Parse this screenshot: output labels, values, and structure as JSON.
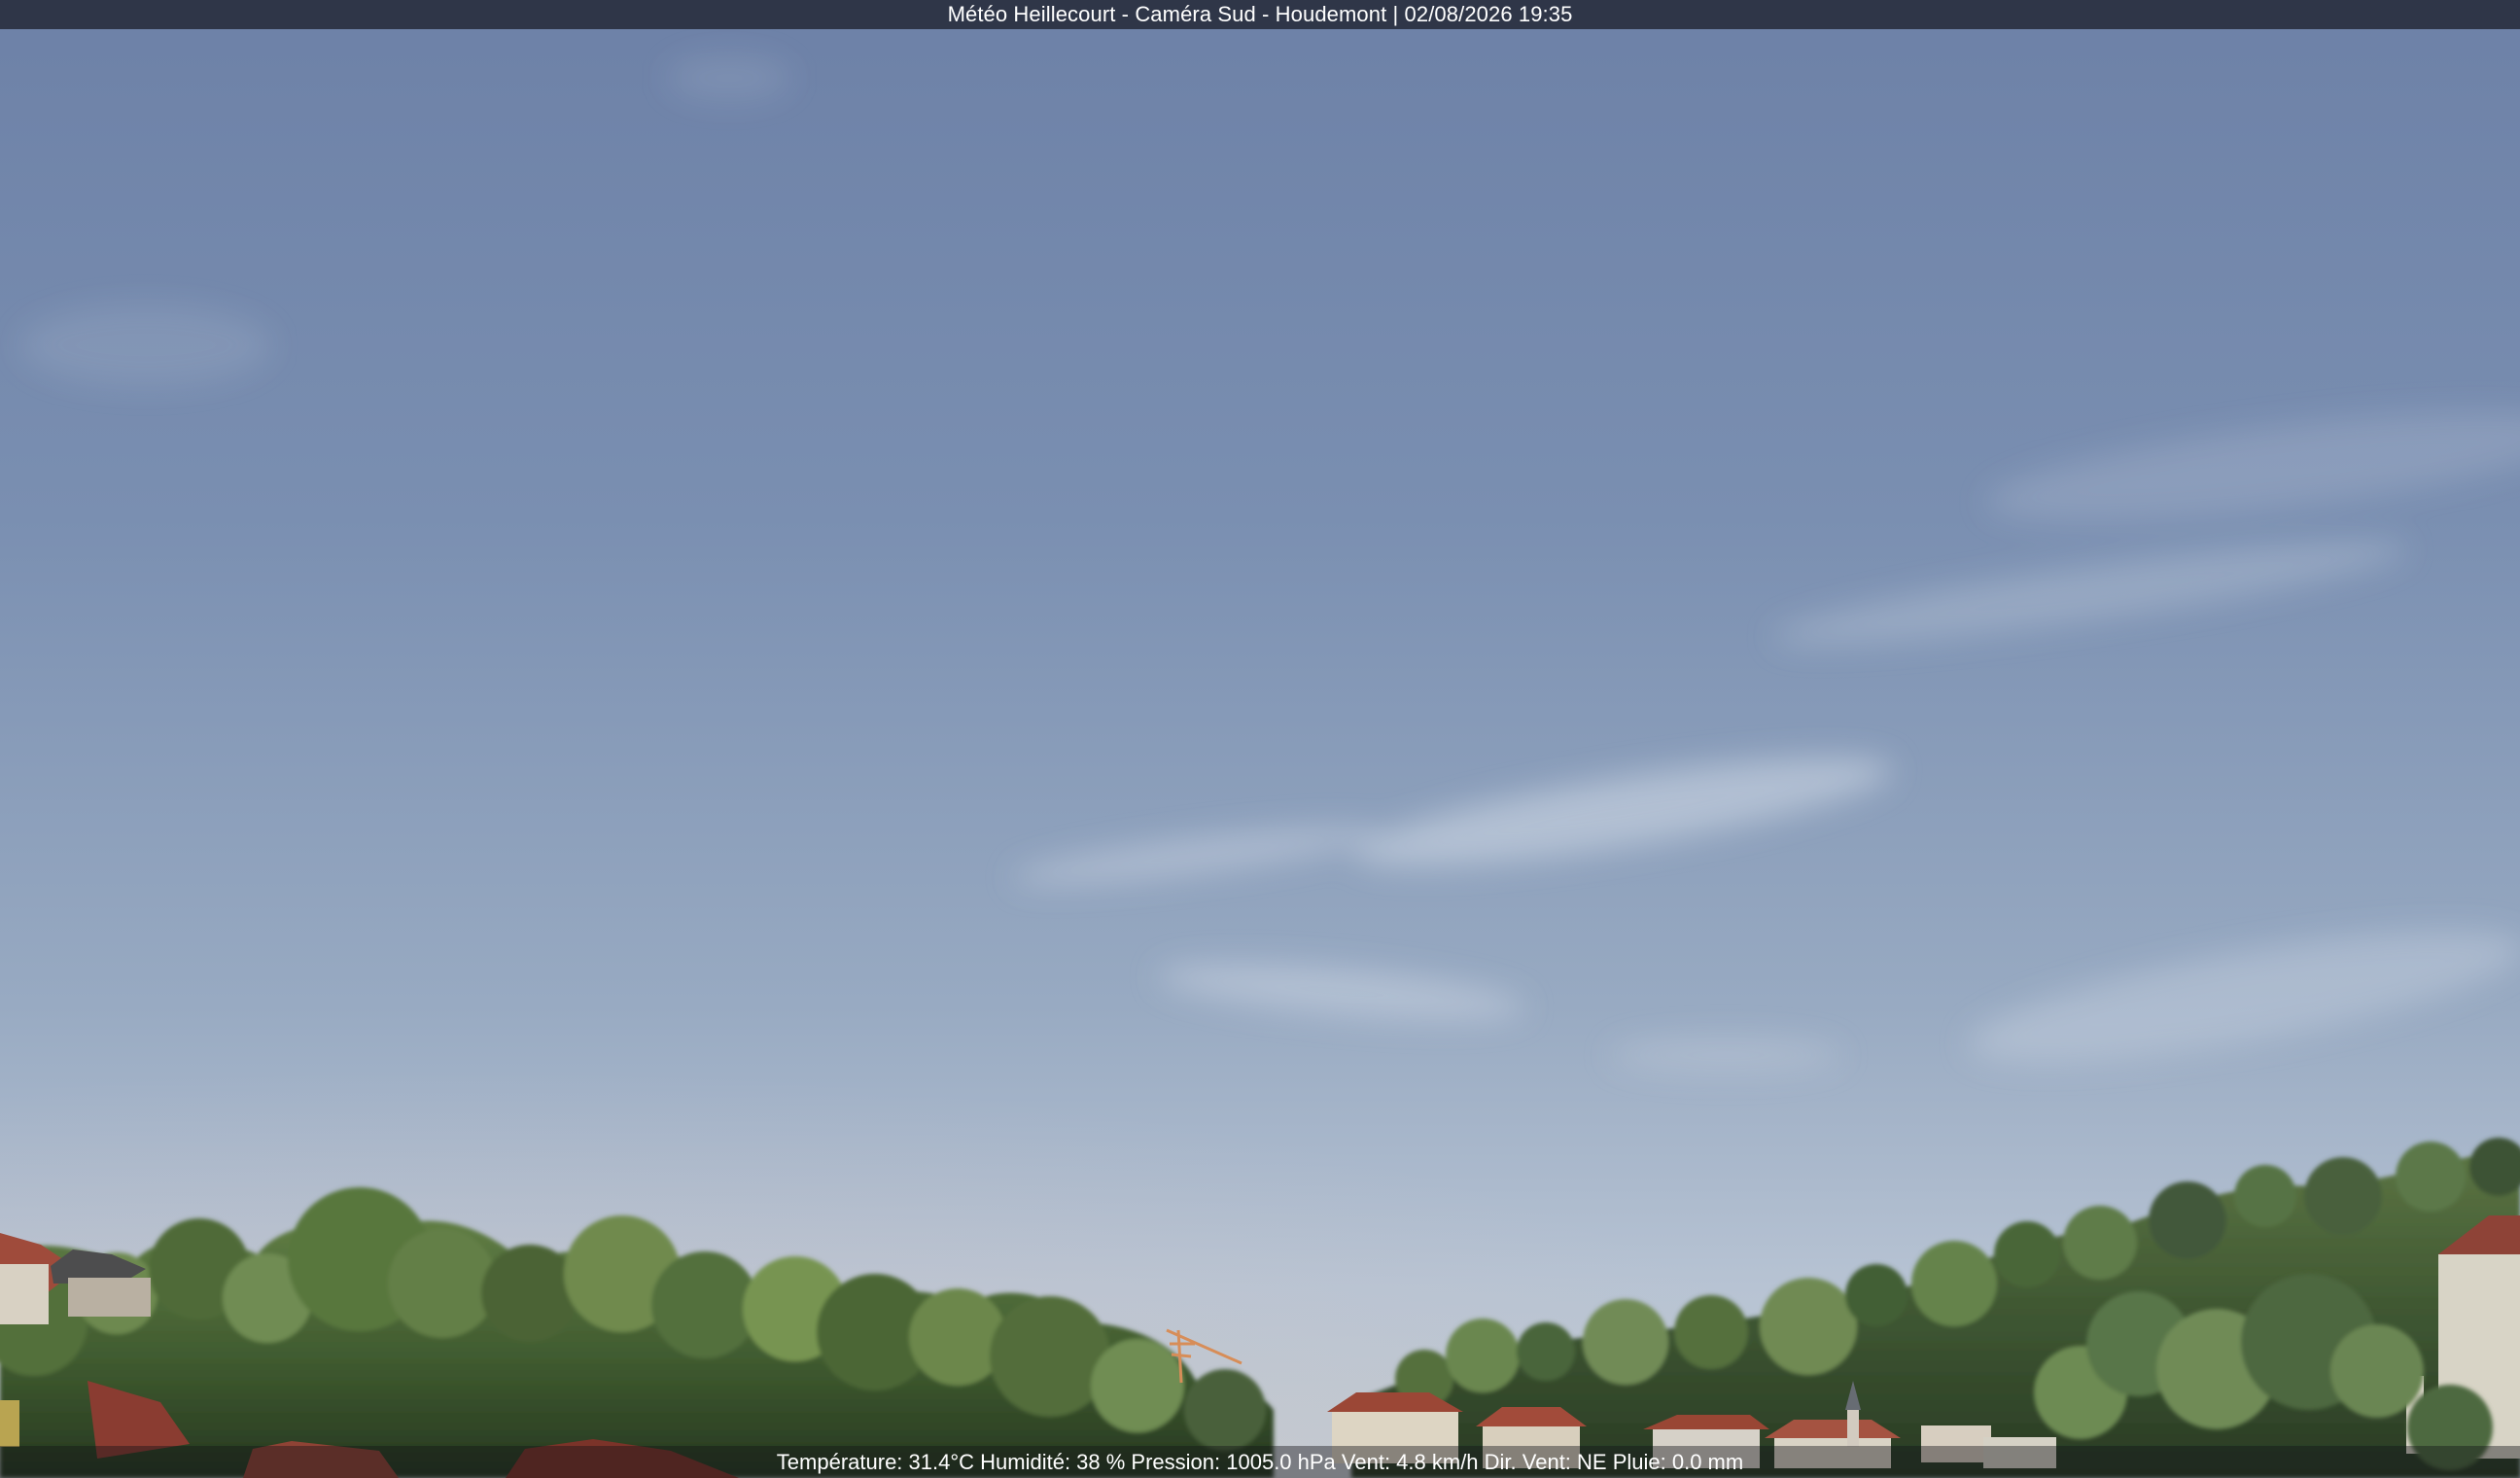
{
  "top_overlay": {
    "text": "Météo Heillecourt - Caméra Sud - Houdemont | 02/08/2026 19:35"
  },
  "bottom_overlay": {
    "text": "Température: 31.4°C  Humidité: 38 % Pression: 1005.0 hPa Vent: 4.8 km/h Dir. Vent: NE Pluie: 0.0 mm"
  },
  "colors": {
    "sky_top": "#6f83a8",
    "sky_mid": "#8398b7",
    "sky_horizon": "#b9c5d2",
    "tree_dark": "#2b3c26",
    "tree_mid": "#4d6a3d",
    "tree_light": "#789255",
    "roof_red": "#9c4838",
    "house_light": "#ddd7c7"
  }
}
